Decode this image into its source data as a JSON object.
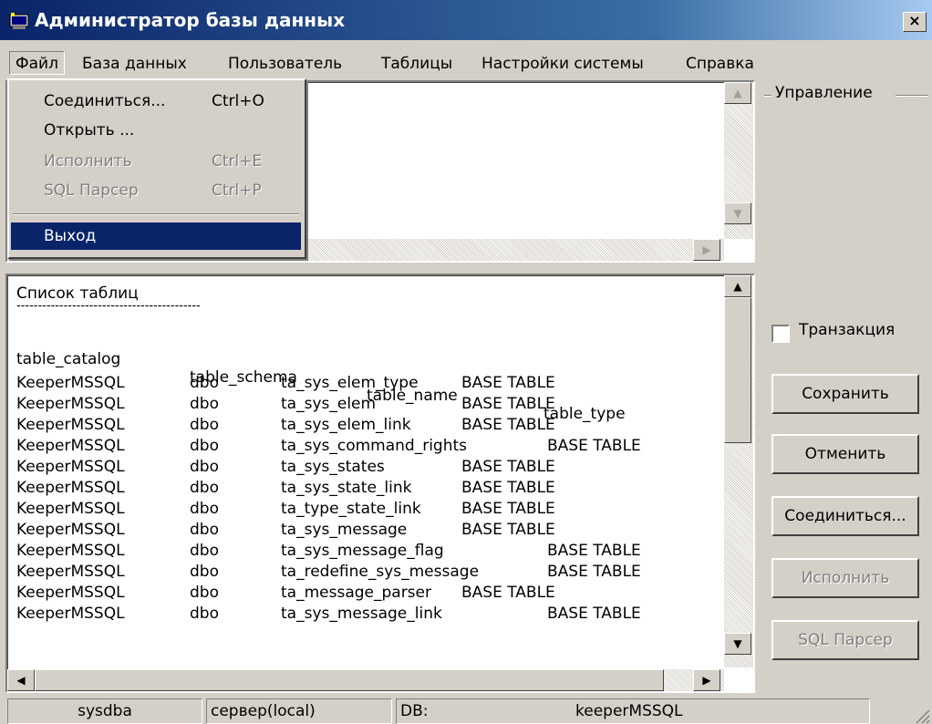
{
  "window": {
    "title": "Администратор базы данных",
    "close_glyph": "×"
  },
  "menu": [
    {
      "label": "Файл",
      "active": true
    },
    {
      "label": "База данных"
    },
    {
      "label": "Пользователь"
    },
    {
      "label": "Таблицы"
    },
    {
      "label": "Настройки системы"
    },
    {
      "label": "Справка"
    }
  ],
  "file_menu": {
    "items": [
      {
        "label": "Соединиться...",
        "shortcut": "Ctrl+O",
        "enabled": true
      },
      {
        "label": "Открыть ...",
        "shortcut": "",
        "enabled": true
      },
      {
        "label": "Исполнить",
        "shortcut": "Ctrl+E",
        "enabled": false
      },
      {
        "label": "SQL Парсер",
        "shortcut": "Ctrl+P",
        "enabled": false
      }
    ],
    "exit_label": "Выход"
  },
  "results": {
    "title": "Список таблиц",
    "divider": "-------------------------------------------",
    "headers": [
      "table_catalog",
      "table_schema",
      "table_name",
      "table_type"
    ],
    "rows": [
      [
        "KeeperMSSQL",
        "dbo",
        "ta_sys_elem_type",
        "BASE TABLE"
      ],
      [
        "KeeperMSSQL",
        "dbo",
        "ta_sys_elem",
        "BASE TABLE"
      ],
      [
        "KeeperMSSQL",
        "dbo",
        "ta_sys_elem_link",
        "BASE TABLE"
      ],
      [
        "KeeperMSSQL",
        "dbo",
        "ta_sys_command_rights",
        "BASE TABLE"
      ],
      [
        "KeeperMSSQL",
        "dbo",
        "ta_sys_states",
        "BASE TABLE"
      ],
      [
        "KeeperMSSQL",
        "dbo",
        "ta_sys_state_link",
        "BASE TABLE"
      ],
      [
        "KeeperMSSQL",
        "dbo",
        "ta_type_state_link",
        "BASE TABLE"
      ],
      [
        "KeeperMSSQL",
        "dbo",
        "ta_sys_message",
        "BASE TABLE"
      ],
      [
        "KeeperMSSQL",
        "dbo",
        "ta_sys_message_flag",
        "BASE TABLE"
      ],
      [
        "KeeperMSSQL",
        "dbo",
        "ta_redefine_sys_message",
        "BASE TABLE"
      ],
      [
        "KeeperMSSQL",
        "dbo",
        "ta_message_parser",
        "BASE TABLE"
      ],
      [
        "KeeperMSSQL",
        "dbo",
        "ta_sys_message_link",
        "BASE TABLE"
      ]
    ]
  },
  "control_panel": {
    "group_title": "Управление",
    "transaction_label": "Транзакция",
    "transaction_checked": false,
    "buttons": [
      {
        "label": "Сохранить",
        "enabled": true
      },
      {
        "label": "Отменить",
        "enabled": true
      },
      {
        "label": "Соединиться...",
        "enabled": true
      },
      {
        "label": "Исполнить",
        "enabled": false
      },
      {
        "label": "SQL Парсер",
        "enabled": false
      }
    ]
  },
  "status": {
    "user": "sysdba",
    "server": "сервер(local)",
    "db_label": "DB:",
    "db_name": "keeperMSSQL"
  },
  "icons": [
    "database-app-icon",
    "close-icon",
    "scroll-up-icon",
    "scroll-down-icon",
    "scroll-left-icon",
    "scroll-right-icon",
    "size-grip-icon"
  ]
}
